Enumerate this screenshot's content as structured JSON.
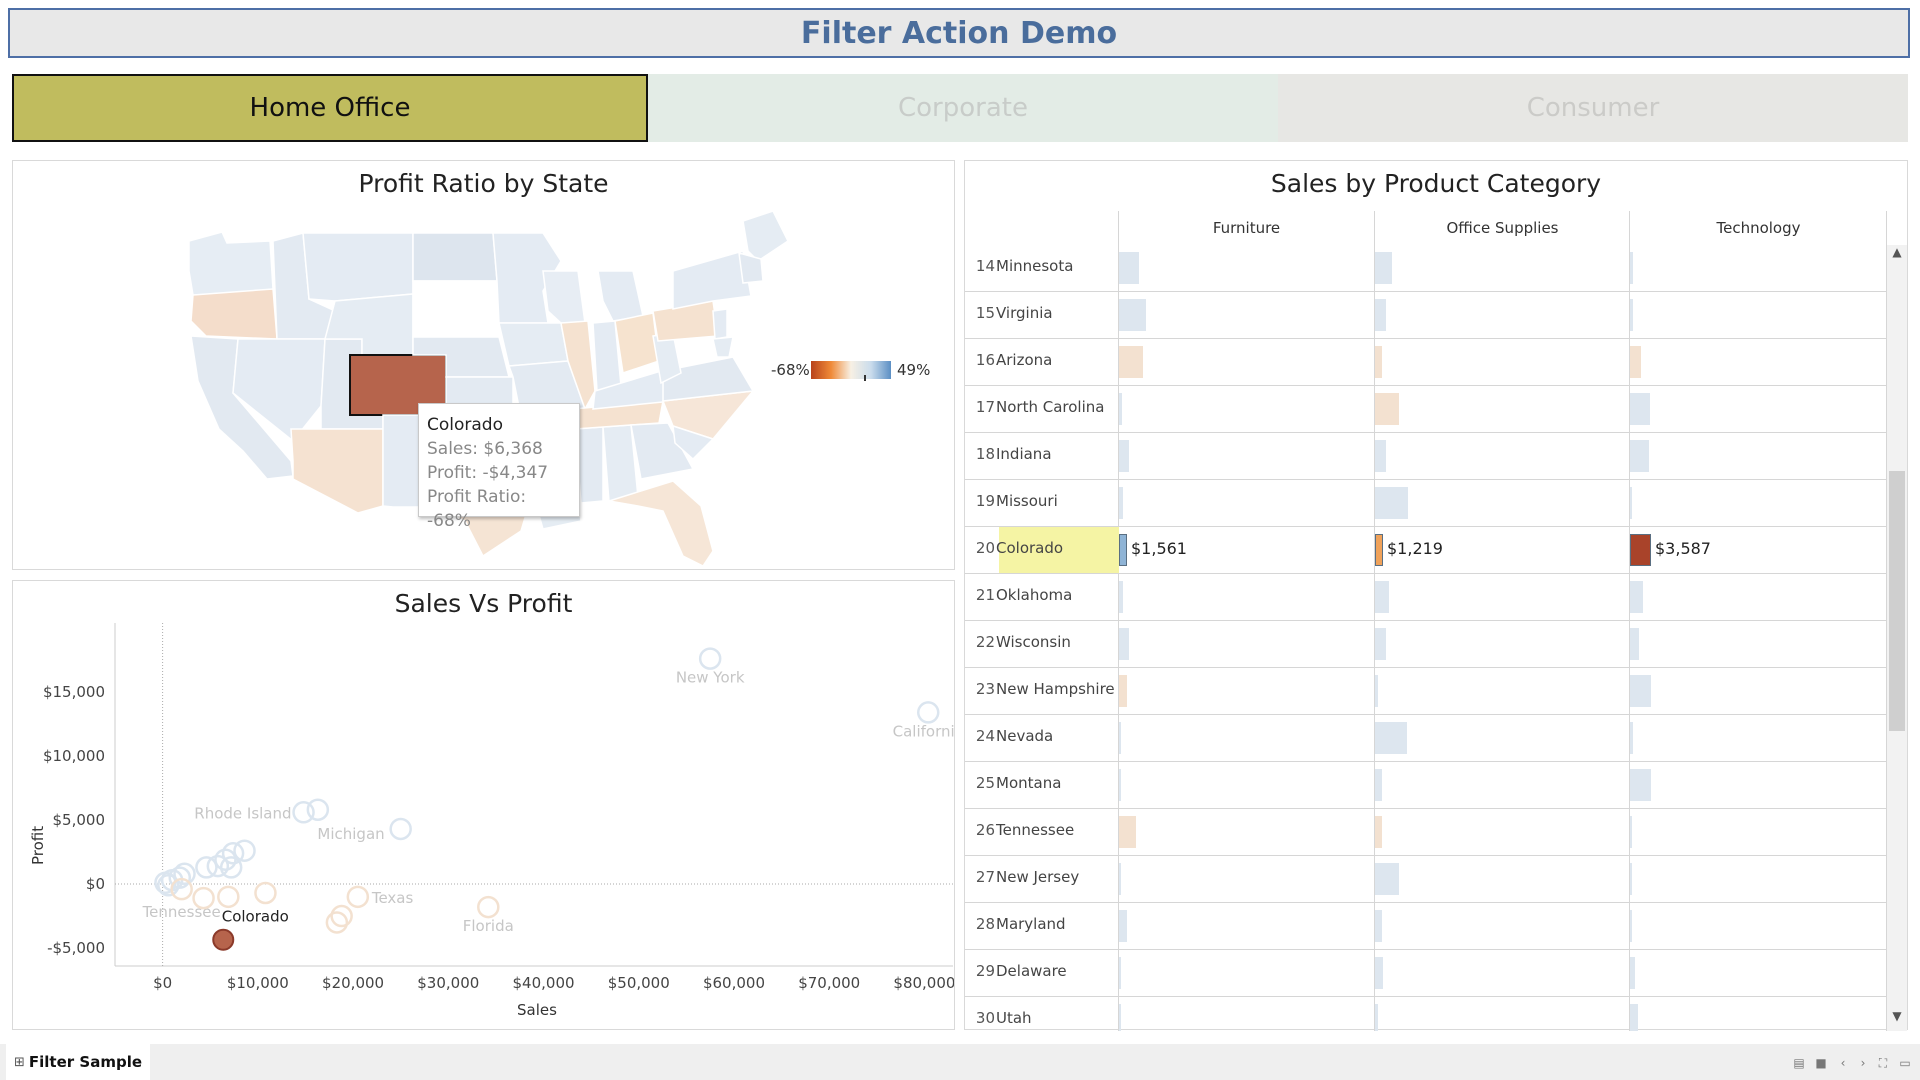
{
  "dashboard": {
    "title": "Filter Action Demo",
    "segments": [
      {
        "label": "Home Office",
        "selected": true
      },
      {
        "label": "Corporate",
        "selected": false
      },
      {
        "label": "Consumer",
        "selected": false
      }
    ]
  },
  "map": {
    "title": "Profit Ratio by State",
    "legend_min": "-68%",
    "legend_max": "49%",
    "tooltip": {
      "state": "Colorado",
      "sales": "Sales: $6,368",
      "profit": "Profit: -$4,347",
      "ratio": "Profit Ratio: -68%"
    }
  },
  "chart_data": {
    "type": "scatter",
    "title": "Sales Vs Profit",
    "xlabel": "Sales",
    "ylabel": "Profit",
    "x_ticks": [
      "$0",
      "$10,000",
      "$20,000",
      "$30,000",
      "$40,000",
      "$50,000",
      "$60,000",
      "$70,000",
      "$80,000"
    ],
    "y_ticks": [
      "$15,000",
      "$10,000",
      "$5,000",
      "$0",
      "-$5,000"
    ],
    "xlim": [
      -5000,
      83000
    ],
    "ylim": [
      -6400,
      19600
    ],
    "points": [
      {
        "label": "New York",
        "x": 57500,
        "y": 17600,
        "color": "#dbe5ef",
        "show_label": true
      },
      {
        "label": "California",
        "x": 80400,
        "y": 13400,
        "color": "#dbe5ef",
        "show_label": true
      },
      {
        "label": "Rhode Island",
        "x": 14800,
        "y": 5600,
        "color": "#dbe5ef",
        "show_label": true
      },
      {
        "label": "",
        "x": 16300,
        "y": 5800,
        "color": "#dbe5ef",
        "show_label": false
      },
      {
        "label": "Michigan",
        "x": 25000,
        "y": 4300,
        "color": "#dbe5ef",
        "show_label": true
      },
      {
        "label": "",
        "x": 8600,
        "y": 2600,
        "color": "#dbe5ef",
        "show_label": false
      },
      {
        "label": "",
        "x": 7400,
        "y": 2400,
        "color": "#dbe5ef",
        "show_label": false
      },
      {
        "label": "",
        "x": 6600,
        "y": 1900,
        "color": "#dbe5ef",
        "show_label": false
      },
      {
        "label": "",
        "x": 5800,
        "y": 1400,
        "color": "#dbe5ef",
        "show_label": false
      },
      {
        "label": "",
        "x": 7200,
        "y": 1300,
        "color": "#dbe5ef",
        "show_label": false
      },
      {
        "label": "",
        "x": 4600,
        "y": 1300,
        "color": "#dbe5ef",
        "show_label": false
      },
      {
        "label": "",
        "x": 2300,
        "y": 800,
        "color": "#dbe5ef",
        "show_label": false
      },
      {
        "label": "",
        "x": 1800,
        "y": 500,
        "color": "#dbe5ef",
        "show_label": false
      },
      {
        "label": "",
        "x": 1000,
        "y": 300,
        "color": "#dbe5ef",
        "show_label": false
      },
      {
        "label": "",
        "x": 300,
        "y": 100,
        "color": "#dbe5ef",
        "show_label": false
      },
      {
        "label": "",
        "x": 600,
        "y": -100,
        "color": "#dbe5ef",
        "show_label": false
      },
      {
        "label": "Tennessee",
        "x": 2000,
        "y": -400,
        "color": "#f3e1d0",
        "show_label": true
      },
      {
        "label": "",
        "x": 4300,
        "y": -1100,
        "color": "#f3e1d0",
        "show_label": false
      },
      {
        "label": "",
        "x": 6900,
        "y": -1000,
        "color": "#f3e1d0",
        "show_label": false
      },
      {
        "label": "",
        "x": 10800,
        "y": -700,
        "color": "#f3e1d0",
        "show_label": false
      },
      {
        "label": "Texas",
        "x": 20500,
        "y": -1000,
        "color": "#f3e1d0",
        "show_label": true
      },
      {
        "label": "",
        "x": 18800,
        "y": -2500,
        "color": "#f3e1d0",
        "show_label": false
      },
      {
        "label": "",
        "x": 18300,
        "y": -3000,
        "color": "#f3e1d0",
        "show_label": false
      },
      {
        "label": "Florida",
        "x": 34200,
        "y": -1800,
        "color": "#f3e1d0",
        "show_label": true
      },
      {
        "label": "Colorado",
        "x": 6368,
        "y": -4347,
        "color": "#b6644c",
        "show_label": true,
        "highlight": true
      }
    ]
  },
  "table": {
    "title": "Sales by Product Category",
    "columns": [
      "Furniture",
      "Office Supplies",
      "Technology"
    ],
    "rows": [
      {
        "num": "14",
        "state": "Minnesota",
        "f": 0.18,
        "o": 0.16,
        "t": 0.03
      },
      {
        "num": "15",
        "state": "Virginia",
        "f": 0.25,
        "o": 0.1,
        "t": 0.03
      },
      {
        "num": "16",
        "state": "Arizona",
        "f": 0.22,
        "o": 0.06,
        "t": 0.1
      },
      {
        "num": "17",
        "state": "North Carolina",
        "f": 0.03,
        "o": 0.22,
        "t": 0.18
      },
      {
        "num": "18",
        "state": "Indiana",
        "f": 0.09,
        "o": 0.1,
        "t": 0.17
      },
      {
        "num": "19",
        "state": "Missouri",
        "f": 0.04,
        "o": 0.3,
        "t": 0.02
      },
      {
        "num": "20",
        "state": "Colorado",
        "f_label": "$1,561",
        "o_label": "$1,219",
        "t_label": "$3,587",
        "f": 0.06,
        "o": 0.06,
        "t": 0.19
      },
      {
        "num": "21",
        "state": "Oklahoma",
        "f": 0.04,
        "o": 0.13,
        "t": 0.12
      },
      {
        "num": "22",
        "state": "Wisconsin",
        "f": 0.09,
        "o": 0.1,
        "t": 0.08
      },
      {
        "num": "23",
        "state": "New Hampshire",
        "f": 0.07,
        "o": 0.03,
        "t": 0.19
      },
      {
        "num": "24",
        "state": "Nevada",
        "f": 0.02,
        "o": 0.29,
        "t": 0.03
      },
      {
        "num": "25",
        "state": "Montana",
        "f": 0.02,
        "o": 0.06,
        "t": 0.19
      },
      {
        "num": "26",
        "state": "Tennessee",
        "f": 0.16,
        "o": 0.06,
        "t": 0.02
      },
      {
        "num": "27",
        "state": "New Jersey",
        "f": 0.02,
        "o": 0.22,
        "t": 0.02
      },
      {
        "num": "28",
        "state": "Maryland",
        "f": 0.07,
        "o": 0.06,
        "t": 0.02
      },
      {
        "num": "29",
        "state": "Delaware",
        "f": 0.02,
        "o": 0.07,
        "t": 0.05
      },
      {
        "num": "30",
        "state": "Utah",
        "f": 0.02,
        "o": 0.03,
        "t": 0.07
      }
    ]
  },
  "footer": {
    "sheet_tab": "Filter Sample"
  },
  "colors": {
    "title_blue": "#4a6d9c",
    "selected_segment": "#c0bc5e",
    "negative": "#b6644c",
    "positive": "#6a97c8"
  }
}
